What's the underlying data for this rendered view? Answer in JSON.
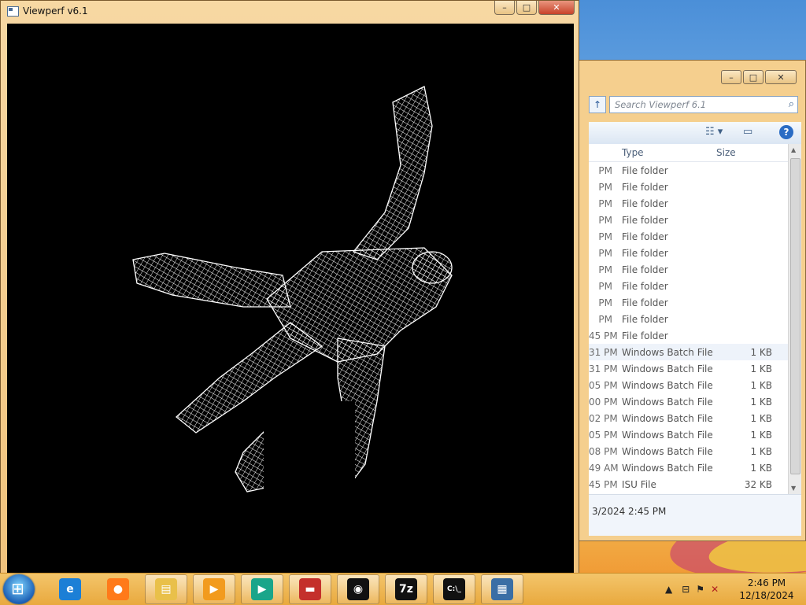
{
  "viewperf": {
    "title": "Viewperf v6.1",
    "controls": {
      "minimize": "–",
      "maximize": "□",
      "close": "✕"
    }
  },
  "explorer": {
    "controls": {
      "minimize": "–",
      "maximize": "□",
      "close": "✕"
    },
    "search_placeholder": "Search Viewperf 6.1",
    "columns": {
      "type": "Type",
      "size": "Size"
    },
    "rows": [
      {
        "date": "PM",
        "type": "File folder",
        "size": ""
      },
      {
        "date": "PM",
        "type": "File folder",
        "size": ""
      },
      {
        "date": "PM",
        "type": "File folder",
        "size": ""
      },
      {
        "date": "PM",
        "type": "File folder",
        "size": ""
      },
      {
        "date": "PM",
        "type": "File folder",
        "size": ""
      },
      {
        "date": "PM",
        "type": "File folder",
        "size": ""
      },
      {
        "date": "PM",
        "type": "File folder",
        "size": ""
      },
      {
        "date": "PM",
        "type": "File folder",
        "size": ""
      },
      {
        "date": "PM",
        "type": "File folder",
        "size": ""
      },
      {
        "date": "PM",
        "type": "File folder",
        "size": ""
      },
      {
        "date": "45 PM",
        "type": "File folder",
        "size": ""
      },
      {
        "date": "31 PM",
        "type": "Windows Batch File",
        "size": "1 KB"
      },
      {
        "date": "31 PM",
        "type": "Windows Batch File",
        "size": "1 KB"
      },
      {
        "date": "05 PM",
        "type": "Windows Batch File",
        "size": "1 KB"
      },
      {
        "date": "00 PM",
        "type": "Windows Batch File",
        "size": "1 KB"
      },
      {
        "date": "02 PM",
        "type": "Windows Batch File",
        "size": "1 KB"
      },
      {
        "date": "05 PM",
        "type": "Windows Batch File",
        "size": "1 KB"
      },
      {
        "date": "08 PM",
        "type": "Windows Batch File",
        "size": "1 KB"
      },
      {
        "date": "49 AM",
        "type": "Windows Batch File",
        "size": "1 KB"
      },
      {
        "date": "45 PM",
        "type": "ISU File",
        "size": "32 KB"
      }
    ],
    "status_text": "3/2024 2:45 PM"
  },
  "taskbar": {
    "apps": [
      {
        "name": "internet-explorer",
        "label": "e",
        "color": "#1c7fd6"
      },
      {
        "name": "firefox",
        "label": "●",
        "color": "#ff7a1a"
      },
      {
        "name": "file-explorer",
        "label": "▤",
        "color": "#e9c04a"
      },
      {
        "name": "media-player",
        "label": "▶",
        "color": "#f29b1e"
      },
      {
        "name": "media-center",
        "label": "▶",
        "color": "#1aa58a"
      },
      {
        "name": "toolbox",
        "label": "▬",
        "color": "#c4302b"
      },
      {
        "name": "github",
        "label": "◉",
        "color": "#111111"
      },
      {
        "name": "7zip",
        "label": "7z",
        "color": "#111111"
      },
      {
        "name": "command-prompt",
        "label": "C:\\_",
        "color": "#111111"
      },
      {
        "name": "viewperf",
        "label": "▦",
        "color": "#3a6ea5"
      }
    ],
    "clock_time": "2:46 PM",
    "clock_date": "12/18/2024",
    "tray_icons": [
      "up-arrow-icon",
      "network-icon",
      "flag-icon",
      "volume-muted-icon"
    ]
  }
}
